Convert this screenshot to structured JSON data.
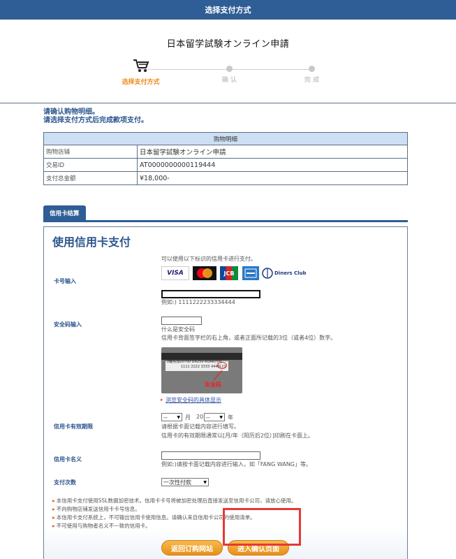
{
  "header": {
    "title": "选择支付方式"
  },
  "site": {
    "title": "日本留学試験オンライン申請"
  },
  "steps": [
    {
      "label": "选择支付方式"
    },
    {
      "label": "确 认"
    },
    {
      "label": "完 成"
    }
  ],
  "notice": {
    "line1": "请确认购物明细。",
    "line2": "请选择支付方式后完成款项支付。"
  },
  "detail": {
    "header": "购物明细",
    "rows": [
      {
        "key": "购物店铺",
        "value": "日本留学試験オンライン申請"
      },
      {
        "key": "交易ID",
        "value": "AT0000000000119444"
      },
      {
        "key": "支付总金额",
        "value": "¥18,000-"
      }
    ]
  },
  "tab": {
    "label": "信用卡结算"
  },
  "panel": {
    "title": "使用信用卡支付",
    "intro": "可以使用以下标识的信用卡进行支付。",
    "brands": {
      "visa": "VISA",
      "jcb": "JCB",
      "diners": "Diners Club"
    },
    "card_number": {
      "label": "卡号输入",
      "value": "",
      "example": "例如:) 1111222233334444"
    },
    "security": {
      "label": "安全码输入",
      "value": "",
      "what": "什么是安全码",
      "desc": "信用卡背面签字栏的右上角，或者正面所记载的3位（或者4位）数字。",
      "card_sig": "2輪島加20700 DR250 ROAR万円",
      "card_num": "1111 2222 3333 4444",
      "card_code": "123",
      "img_label": "安全码",
      "link": "浏览安全码的具体显示"
    },
    "expiry": {
      "label": "信用卡有效期限",
      "month_value": "--",
      "month_unit": "月",
      "year_prefix": "20",
      "year_value": "--",
      "year_unit": "年",
      "note1": "请根据卡面记载内容进行填写。",
      "note2": "信用卡的有效期限通常以[月/年（阳历后2位）]印刷在卡面上。"
    },
    "name": {
      "label": "信用卡名义",
      "value": "",
      "example": "例如:)请按卡面记载内容进行输入，如「FANG WANG」等。"
    },
    "installments": {
      "label": "支付次数",
      "value": "一次性付款"
    },
    "notes": [
      "本信用卡支付使用SSL数据加密技术。信用卡卡号将被加密处理后直接发送至信用卡公司，请放心使用。",
      "不向购物店铺发送信用卡卡号信息。",
      "本信用卡支付系统上，不可输出信用卡使用信息。请确认来自信用卡公司的使用清单。",
      "不可使用与购物者名义不一致的信用卡。"
    ],
    "buttons": {
      "back": "返回订购网站",
      "confirm": "进入确认页面"
    }
  },
  "colors": {
    "primary": "#2f5d96",
    "accent": "#f08a1c",
    "highlight": "#e53935"
  }
}
